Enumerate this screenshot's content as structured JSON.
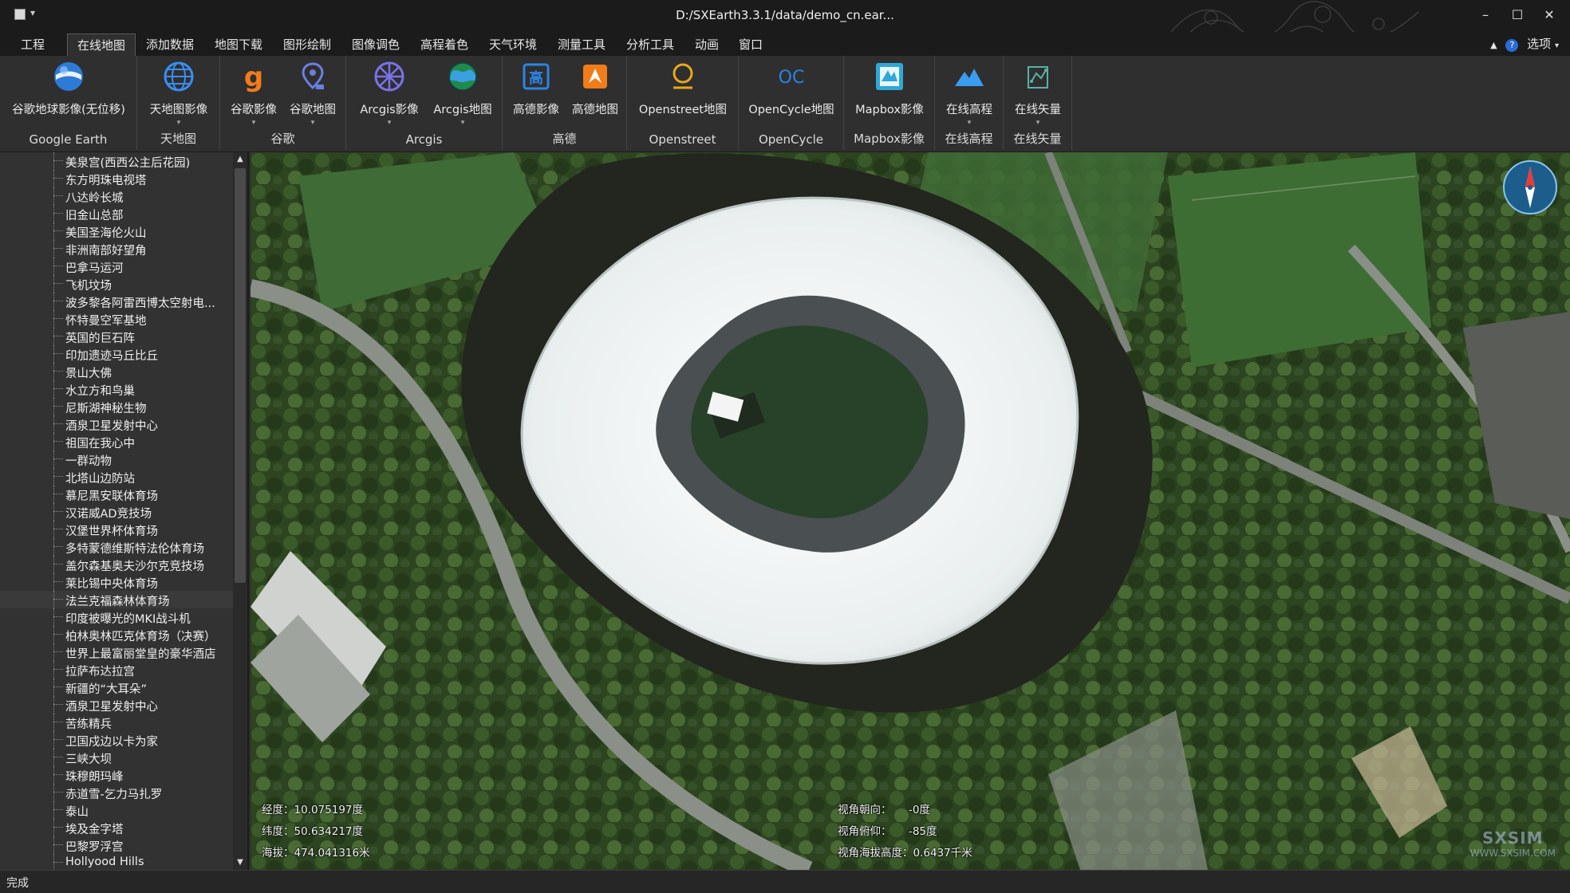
{
  "window": {
    "title": "D:/SXEarth3.3.1/data/demo_cn.ear...",
    "controls": {
      "minimize": "–",
      "maximize": "☐",
      "close": "✕"
    }
  },
  "menu": {
    "tabs": [
      "工程",
      "在线地图",
      "添加数据",
      "地图下载",
      "图形绘制",
      "图像调色",
      "高程着色",
      "天气环境",
      "测量工具",
      "分析工具",
      "动画",
      "窗口"
    ],
    "active_tab": "在线地图",
    "options_label": "选项"
  },
  "ribbon": {
    "groups": [
      {
        "label": "Google Earth",
        "buttons": [
          {
            "label": "谷歌地球影像(无位移)",
            "icon": "google-earth-icon"
          }
        ]
      },
      {
        "label": "天地图",
        "buttons": [
          {
            "label": "天地图影像",
            "icon": "tianditu-globe-icon"
          }
        ]
      },
      {
        "label": "谷歌",
        "buttons": [
          {
            "label": "谷歌影像",
            "icon": "google-g-icon"
          },
          {
            "label": "谷歌地图",
            "icon": "google-maps-pin-icon"
          }
        ]
      },
      {
        "label": "Arcgis",
        "buttons": [
          {
            "label": "Arcgis影像",
            "icon": "arcgis-icon"
          },
          {
            "label": "Arcgis地图",
            "icon": "arcgis-globe-icon"
          }
        ]
      },
      {
        "label": "高德",
        "buttons": [
          {
            "label": "高德影像",
            "icon": "gaode-image-icon"
          },
          {
            "label": "高德地图",
            "icon": "gaode-map-icon"
          }
        ]
      },
      {
        "label": "Openstreet",
        "buttons": [
          {
            "label": "Openstreet地图",
            "icon": "openstreetmap-icon"
          }
        ]
      },
      {
        "label": "OpenCycle",
        "buttons": [
          {
            "label": "OpenCycle地图",
            "icon": "opencycle-icon"
          }
        ]
      },
      {
        "label": "Mapbox影像",
        "buttons": [
          {
            "label": "Mapbox影像",
            "icon": "mapbox-icon"
          }
        ]
      },
      {
        "label": "在线高程",
        "buttons": [
          {
            "label": "在线高程",
            "icon": "mountain-elevation-icon"
          }
        ]
      },
      {
        "label": "在线矢量",
        "buttons": [
          {
            "label": "在线矢量",
            "icon": "vector-layer-icon"
          }
        ]
      }
    ]
  },
  "tree": {
    "items": [
      "美泉宫(西西公主后花园)",
      "东方明珠电视塔",
      "八达岭长城",
      "旧金山总部",
      "美国圣海伦火山",
      "非洲南部好望角",
      "巴拿马运河",
      "飞机坟场",
      "波多黎各阿雷西博太空射电...",
      "怀特曼空军基地",
      "英国的巨石阵",
      "印加遗迹马丘比丘",
      "景山大佛",
      "水立方和鸟巢",
      "尼斯湖神秘生物",
      "酒泉卫星发射中心",
      "祖国在我心中",
      "一群动物",
      "北塔山边防站",
      "慕尼黑安联体育场",
      "汉诺威AD竞技场",
      "汉堡世界杯体育场",
      "多特蒙德维斯特法伦体育场",
      "盖尔森基奥夫沙尔克竞技场",
      "莱比锡中央体育场",
      "法兰克福森林体育场",
      "印度被曝光的MKI战斗机",
      "柏林奥林匹克体育场（决赛）",
      "世界上最富丽堂皇的豪华酒店",
      "拉萨布达拉宫",
      "新疆的“大耳朵”",
      "酒泉卫星发射中心",
      "苦练精兵",
      "卫国戍边以卡为家",
      "三峡大坝",
      "珠穆朗玛峰",
      "赤道雪-乞力马扎罗",
      "泰山",
      "埃及金字塔",
      "巴黎罗浮宫",
      "Hollyood Hills"
    ],
    "selected_index": 25
  },
  "map": {
    "longitude": "经度：10.075197度",
    "latitude": "纬度：50.634217度",
    "altitude": "海拔：474.041316米",
    "heading": "视角朝向：     -0度",
    "pitch": "视角俯仰：     -85度",
    "view_height": "视角海拔高度：0.6437千米",
    "watermark": "SXSIM",
    "watermark_url": "WWW.SXSIM.COM"
  },
  "status": {
    "text": "完成"
  },
  "colors": {
    "background": "#2b2b2b",
    "titlebar": "#1b1b1b",
    "ribbon": "#2f2f2f",
    "accent_blue": "#1e6fd9",
    "accent_orange": "#f07d1a"
  }
}
